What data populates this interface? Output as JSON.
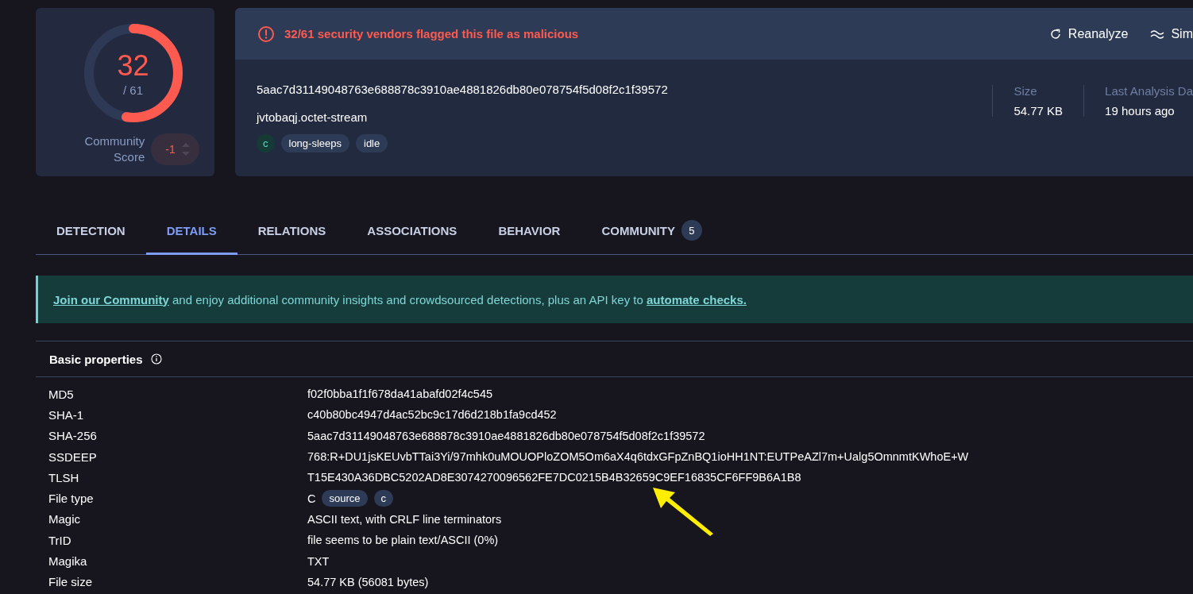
{
  "score": {
    "detections": "32",
    "total": "/ 61",
    "level": 0.525,
    "community_label": "Community Score",
    "community_value": "-1"
  },
  "header": {
    "alert": "32/61 security vendors flagged this file as malicious",
    "actions": [
      {
        "kind": "reanalyze",
        "label": "Reanalyze"
      },
      {
        "kind": "similar",
        "label": "Sim"
      }
    ],
    "hash": "5aac7d31149048763e688878c3910ae4881826db80e078754f5d08f2c1f39572",
    "filename": "jvtobaqj.octet-stream",
    "tags": [
      {
        "kind": "filetype",
        "label": "c"
      },
      {
        "kind": "tag",
        "label": "long-sleeps"
      },
      {
        "kind": "tag",
        "label": "idle"
      }
    ],
    "metrics": [
      {
        "label": "Size",
        "value": "54.77 KB"
      },
      {
        "label": "Last Analysis Da",
        "value": "19 hours ago"
      }
    ]
  },
  "tabs": [
    {
      "label": "DETECTION",
      "selected": false
    },
    {
      "label": "DETAILS",
      "selected": true
    },
    {
      "label": "RELATIONS",
      "selected": false
    },
    {
      "label": "ASSOCIATIONS",
      "selected": false
    },
    {
      "label": "BEHAVIOR",
      "selected": false
    },
    {
      "label": "COMMUNITY",
      "selected": false,
      "badge": "5"
    }
  ],
  "banner": [
    {
      "kind": "link",
      "text": "Join our Community"
    },
    {
      "kind": "text",
      "text": " and enjoy additional community insights and crowdsourced detections, plus an API key to "
    },
    {
      "kind": "link",
      "text": "automate checks."
    }
  ],
  "properties": {
    "title": "Basic properties",
    "rows": [
      {
        "label": "MD5",
        "value": "f02f0bba1f1f678da41abafd02f4c545"
      },
      {
        "label": "SHA-1",
        "value": "c40b80bc4947d4ac52bc9c17d6d218b1fa9cd452"
      },
      {
        "label": "SHA-256",
        "value": "5aac7d31149048763e688878c3910ae4881826db80e078754f5d08f2c1f39572"
      },
      {
        "label": "SSDEEP",
        "value": "768:R+DU1jsKEUvbTTai3Yi/97mhk0uMOUOPloZOM5Om6aX4q6tdxGFpZnBQ1ioHH1NT:EUTPeAZl7m+Ualg5OmnmtKWhoE+W"
      },
      {
        "label": "TLSH",
        "value": "T15E430A36DBC5202AD8E3074270096562FE7DC0215B4B32659C9EF16835CF6FF9B6A1B8"
      },
      {
        "label": "File type",
        "value": "C",
        "tags": [
          "source",
          "c"
        ]
      },
      {
        "label": "Magic",
        "value": "ASCII text, with CRLF line terminators"
      },
      {
        "label": "TrID",
        "value": "file seems to be plain text/ASCII (0%)"
      },
      {
        "label": "Magika",
        "value": "TXT"
      },
      {
        "label": "File size",
        "value": "54.77 KB (56081 bytes)"
      }
    ]
  }
}
